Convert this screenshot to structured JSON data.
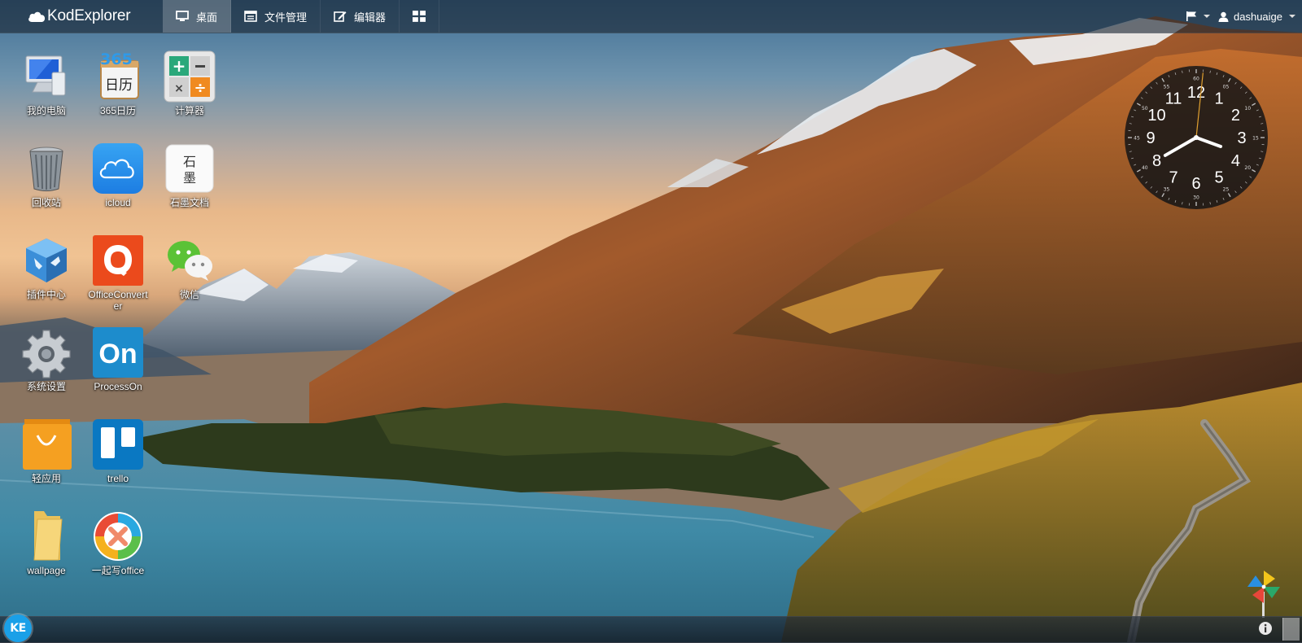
{
  "app": {
    "brand": "KodExplorer"
  },
  "nav": {
    "desktop": "桌面",
    "files": "文件管理",
    "editor": "编辑器"
  },
  "user": {
    "name": "dashuaige"
  },
  "desktop_icons": [
    {
      "label": "我的电脑",
      "icon": "computer-icon"
    },
    {
      "label": "365日历",
      "icon": "calendar-365-icon",
      "icon_text": "日历",
      "icon_number": "365"
    },
    {
      "label": "计算器",
      "icon": "calculator-icon"
    },
    {
      "label": "回收站",
      "icon": "recycle-bin-icon"
    },
    {
      "label": "icloud",
      "icon": "icloud-icon"
    },
    {
      "label": "石墨文档",
      "icon": "shimo-docs-icon",
      "icon_text_1": "石",
      "icon_text_2": "墨"
    },
    {
      "label": "插件中心",
      "icon": "plugin-center-icon"
    },
    {
      "label": "OfficeConverter",
      "icon": "office-converter-icon"
    },
    {
      "label": "微信",
      "icon": "wechat-icon"
    },
    {
      "label": "系统设置",
      "icon": "settings-gear-icon"
    },
    {
      "label": "ProcessOn",
      "icon": "processon-icon",
      "icon_text": "On"
    },
    {
      "label": "轻应用",
      "icon": "light-app-bag-icon"
    },
    {
      "label": "trello",
      "icon": "trello-icon"
    },
    {
      "label": "wallpage",
      "icon": "folder-icon"
    },
    {
      "label": "一起写office",
      "icon": "yiqixie-office-icon"
    }
  ],
  "clock": {
    "hours": [
      "12",
      "1",
      "2",
      "3",
      "4",
      "5",
      "6",
      "7",
      "8",
      "9",
      "10",
      "11"
    ],
    "minutes": [
      "60",
      "05",
      "10",
      "15",
      "20",
      "25",
      "30",
      "35",
      "40",
      "45",
      "50",
      "55"
    ],
    "time": {
      "hour": 3,
      "minute": 40,
      "second": 1
    }
  },
  "taskbar": {
    "start_label": "KE"
  },
  "colors": {
    "accent": "#1aa0e8",
    "clock_second_hand": "#e0a030",
    "topbar": "rgba(25,35,48,0.62)"
  }
}
